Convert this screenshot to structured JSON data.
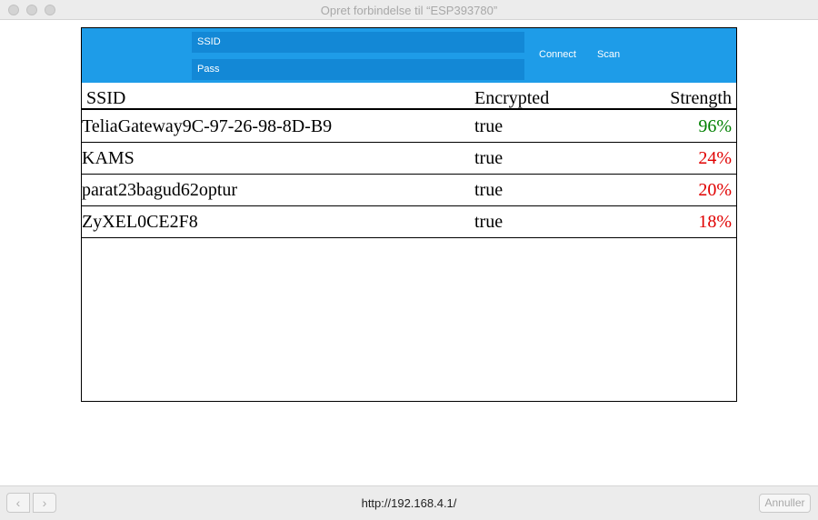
{
  "window": {
    "title": "Opret forbindelse til “ESP393780”"
  },
  "form": {
    "ssid_label": "SSID",
    "pass_label": "Pass",
    "connect_label": "Connect",
    "scan_label": "Scan"
  },
  "table": {
    "columns": [
      "SSID",
      "Encrypted",
      "Strength"
    ],
    "rows": [
      {
        "ssid": "TeliaGateway9C-97-26-98-8D-B9",
        "encrypted": "true",
        "strength": "96%",
        "strength_color": "#008000"
      },
      {
        "ssid": "KAMS",
        "encrypted": "true",
        "strength": "24%",
        "strength_color": "#e00000"
      },
      {
        "ssid": "parat23bagud62optur",
        "encrypted": "true",
        "strength": "20%",
        "strength_color": "#e00000"
      },
      {
        "ssid": "ZyXEL0CE2F8",
        "encrypted": "true",
        "strength": "18%",
        "strength_color": "#e00000"
      }
    ]
  },
  "bottombar": {
    "url": "http://192.168.4.1/",
    "cancel_label": "Annuller",
    "back_icon": "chevron-left-icon",
    "forward_icon": "chevron-right-icon"
  },
  "colors": {
    "accent": "#1e9ce8",
    "field": "#1388d6"
  }
}
